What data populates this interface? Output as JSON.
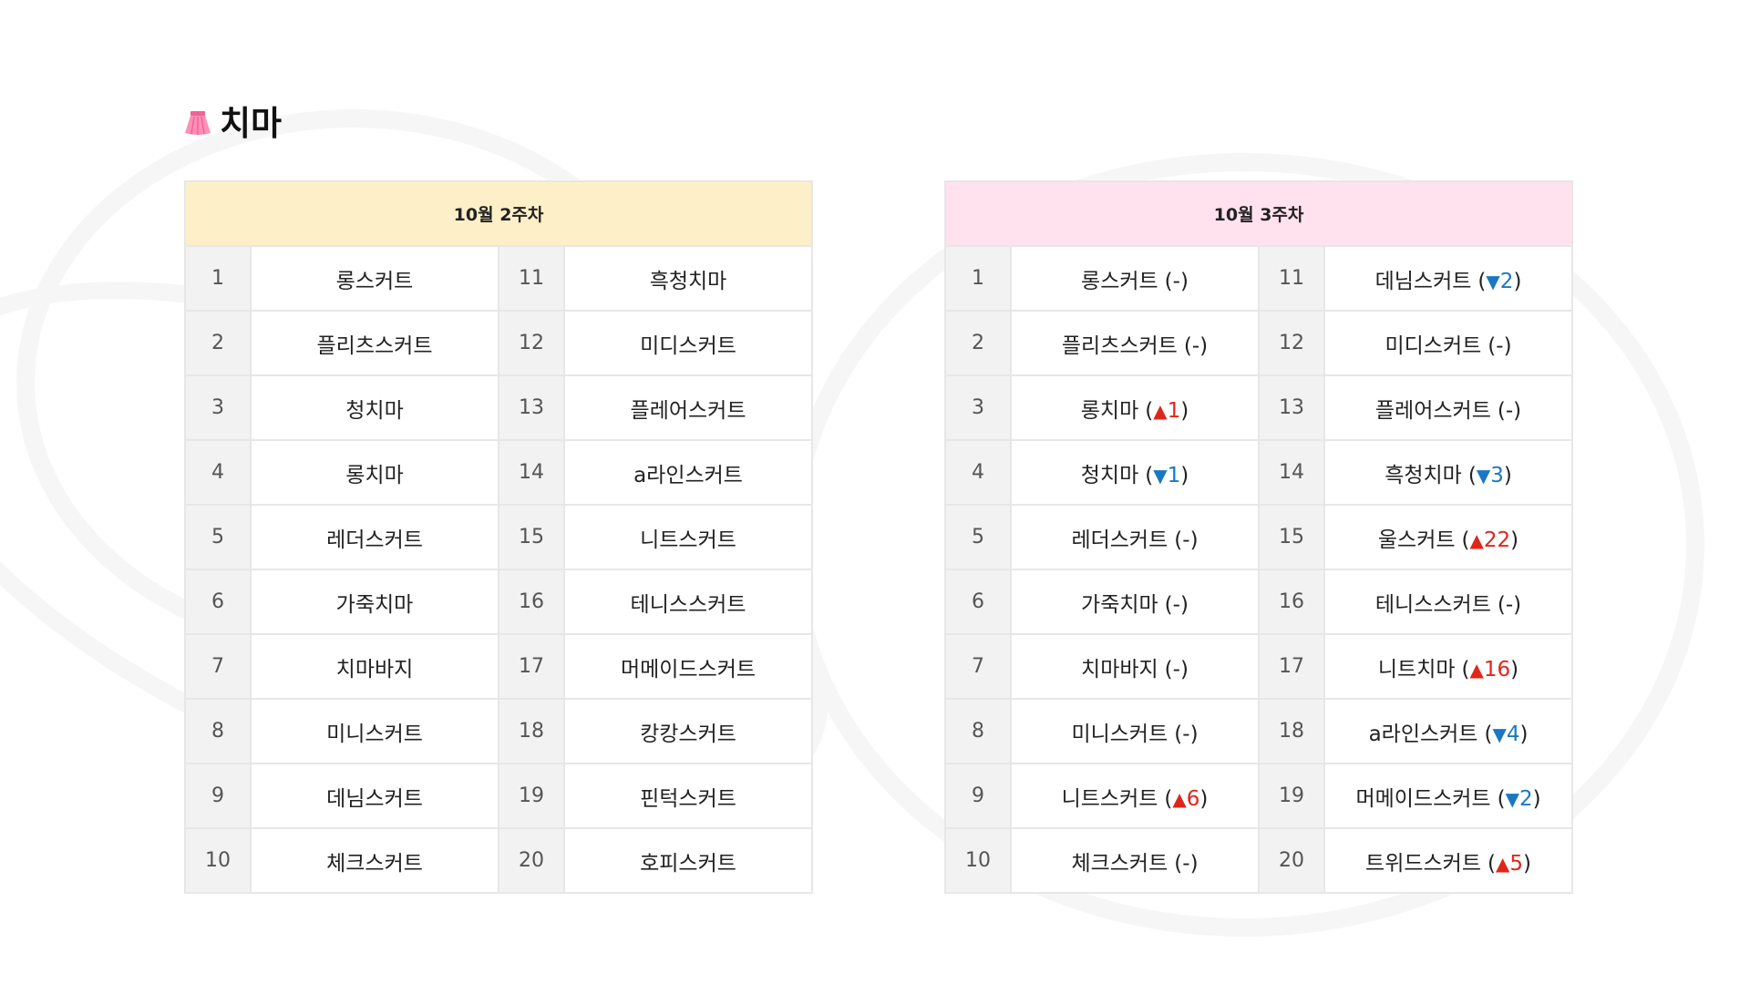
{
  "title": "치마",
  "icon": "skirt-icon",
  "colors": {
    "up": "#e0251b",
    "down": "#1a78c2",
    "week2_header": "#fdf0c8",
    "week3_header": "#ffe2ee"
  },
  "week2": {
    "header": "10월 2주차",
    "rows": [
      {
        "rank": "1",
        "name": "롱스커트"
      },
      {
        "rank": "2",
        "name": "플리츠스커트"
      },
      {
        "rank": "3",
        "name": "청치마"
      },
      {
        "rank": "4",
        "name": "롱치마"
      },
      {
        "rank": "5",
        "name": "레더스커트"
      },
      {
        "rank": "6",
        "name": "가죽치마"
      },
      {
        "rank": "7",
        "name": "치마바지"
      },
      {
        "rank": "8",
        "name": "미니스커트"
      },
      {
        "rank": "9",
        "name": "데님스커트"
      },
      {
        "rank": "10",
        "name": "체크스커트"
      },
      {
        "rank": "11",
        "name": "흑청치마"
      },
      {
        "rank": "12",
        "name": "미디스커트"
      },
      {
        "rank": "13",
        "name": "플레어스커트"
      },
      {
        "rank": "14",
        "name": "a라인스커트"
      },
      {
        "rank": "15",
        "name": "니트스커트"
      },
      {
        "rank": "16",
        "name": "테니스스커트"
      },
      {
        "rank": "17",
        "name": "머메이드스커트"
      },
      {
        "rank": "18",
        "name": "캉캉스커트"
      },
      {
        "rank": "19",
        "name": "핀턱스커트"
      },
      {
        "rank": "20",
        "name": "호피스커트"
      }
    ]
  },
  "week3": {
    "header": "10월 3주차",
    "rows": [
      {
        "rank": "1",
        "name": "롱스커트",
        "dir": "same",
        "change": "-"
      },
      {
        "rank": "2",
        "name": "플리츠스커트",
        "dir": "same",
        "change": "-"
      },
      {
        "rank": "3",
        "name": "롱치마",
        "dir": "up",
        "change": "1"
      },
      {
        "rank": "4",
        "name": "청치마",
        "dir": "down",
        "change": "1"
      },
      {
        "rank": "5",
        "name": "레더스커트",
        "dir": "same",
        "change": "-"
      },
      {
        "rank": "6",
        "name": "가죽치마",
        "dir": "same",
        "change": "-"
      },
      {
        "rank": "7",
        "name": "치마바지",
        "dir": "same",
        "change": "-"
      },
      {
        "rank": "8",
        "name": "미니스커트",
        "dir": "same",
        "change": "-"
      },
      {
        "rank": "9",
        "name": "니트스커트",
        "dir": "up",
        "change": "6"
      },
      {
        "rank": "10",
        "name": "체크스커트",
        "dir": "same",
        "change": "-"
      },
      {
        "rank": "11",
        "name": "데님스커트",
        "dir": "down",
        "change": "2"
      },
      {
        "rank": "12",
        "name": "미디스커트",
        "dir": "same",
        "change": "-"
      },
      {
        "rank": "13",
        "name": "플레어스커트",
        "dir": "same",
        "change": "-"
      },
      {
        "rank": "14",
        "name": "흑청치마",
        "dir": "down",
        "change": "3"
      },
      {
        "rank": "15",
        "name": "울스커트",
        "dir": "up",
        "change": "22"
      },
      {
        "rank": "16",
        "name": "테니스스커트",
        "dir": "same",
        "change": "-"
      },
      {
        "rank": "17",
        "name": "니트치마",
        "dir": "up",
        "change": "16"
      },
      {
        "rank": "18",
        "name": "a라인스커트",
        "dir": "down",
        "change": "4"
      },
      {
        "rank": "19",
        "name": "머메이드스커트",
        "dir": "down",
        "change": "2"
      },
      {
        "rank": "20",
        "name": "트위드스커트",
        "dir": "up",
        "change": "5"
      }
    ]
  }
}
